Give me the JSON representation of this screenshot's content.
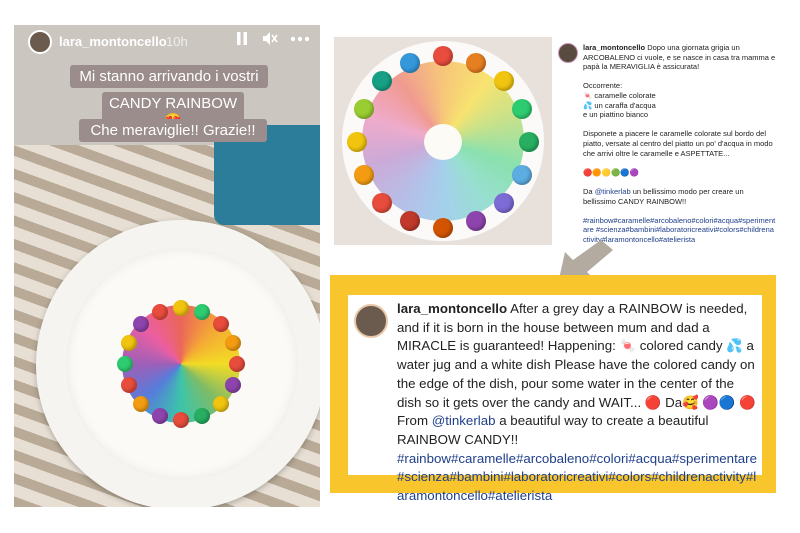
{
  "story": {
    "username": "lara_montoncello",
    "time": "10h",
    "pause_icon": "pause-icon",
    "mute_icon": "mute-icon",
    "more_icon": "more-icon",
    "sticker_lines": [
      "Mi stanno arrivando i vostri",
      "CANDY RAINBOW 😍",
      "Che meraviglie!! Grazie!!"
    ]
  },
  "post": {
    "username": "lara_montoncello",
    "intro": "Dopo una giornata grigia un ARCOBALENO ci vuole, e se nasce in casa tra mamma e papà la MERAVIGLIA è assicurata!",
    "occorrente_title": "Occorrente:",
    "items": [
      "🍬 caramelle colorate",
      "💦 un caraffa d'acqua",
      "e un piattino bianco"
    ],
    "instructions": "Disponete a piacere le caramelle colorate sul bordo del piatto, versate al centro del piatto un po' d'acqua in modo che arrivi oltre le caramelle e ASPETTATE...",
    "emoji_row": "🔴🟠🟡🟢🔵🟣",
    "credit_prefix": "Da",
    "credit_handle": "@tinkerlab",
    "credit_suffix": "un bellissimo modo per creare un bellissimo CANDY RAINBOW!!",
    "hashtags": "#rainbow#caramelle#arcobaleno#colori#acqua#sperimentare #scienza#bambini#laboratoricreativi#colors#childrenactivity#laramontoncello#atelierista"
  },
  "translation": {
    "username": "lara_montoncello",
    "text_part1": "After a grey day a RAINBOW is needed, and if it is born in the house between mum and dad a MIRACLE is guaranteed! Happening: 🍬 colored candy 💦 a water jug and a white dish Please have the colored candy on the edge of the dish, pour some water in the center of the dish so it gets over the candy and WAIT... 🔴 Da🥰 🟣🔵 🔴 From",
    "handle": "@tinkerlab",
    "text_part2": "a beautiful way to create a beautiful RAINBOW CANDY!!",
    "hashtags": "#rainbow#caramelle#arcobaleno#colori#acqua#sperimentare #scienza#bambini#laboratoricreativi#colors#childrenactivity#laramontoncello#atelierista"
  },
  "colors": {
    "frame_yellow": "#f8c52d",
    "link_blue": "#1f3f8a",
    "arrow_gray": "#b3aaa0"
  }
}
